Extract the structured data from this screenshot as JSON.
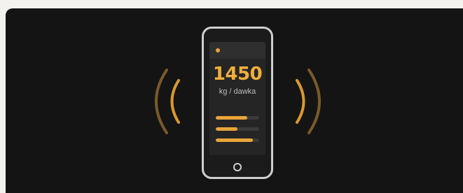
{
  "colors": {
    "background": "#141414",
    "accent": "#e8a53a",
    "frame": "#cfcfcf"
  },
  "icons": {
    "left_signal": "signal-waves-left-icon",
    "right_signal": "signal-waves-right-icon",
    "status": "status-dot-icon",
    "home": "home-button-icon"
  },
  "phone": {
    "value": "1450",
    "unit": "kg / dawka",
    "bars": [
      {
        "level": 0.72
      },
      {
        "level": 0.5
      },
      {
        "level": 0.86
      }
    ]
  }
}
